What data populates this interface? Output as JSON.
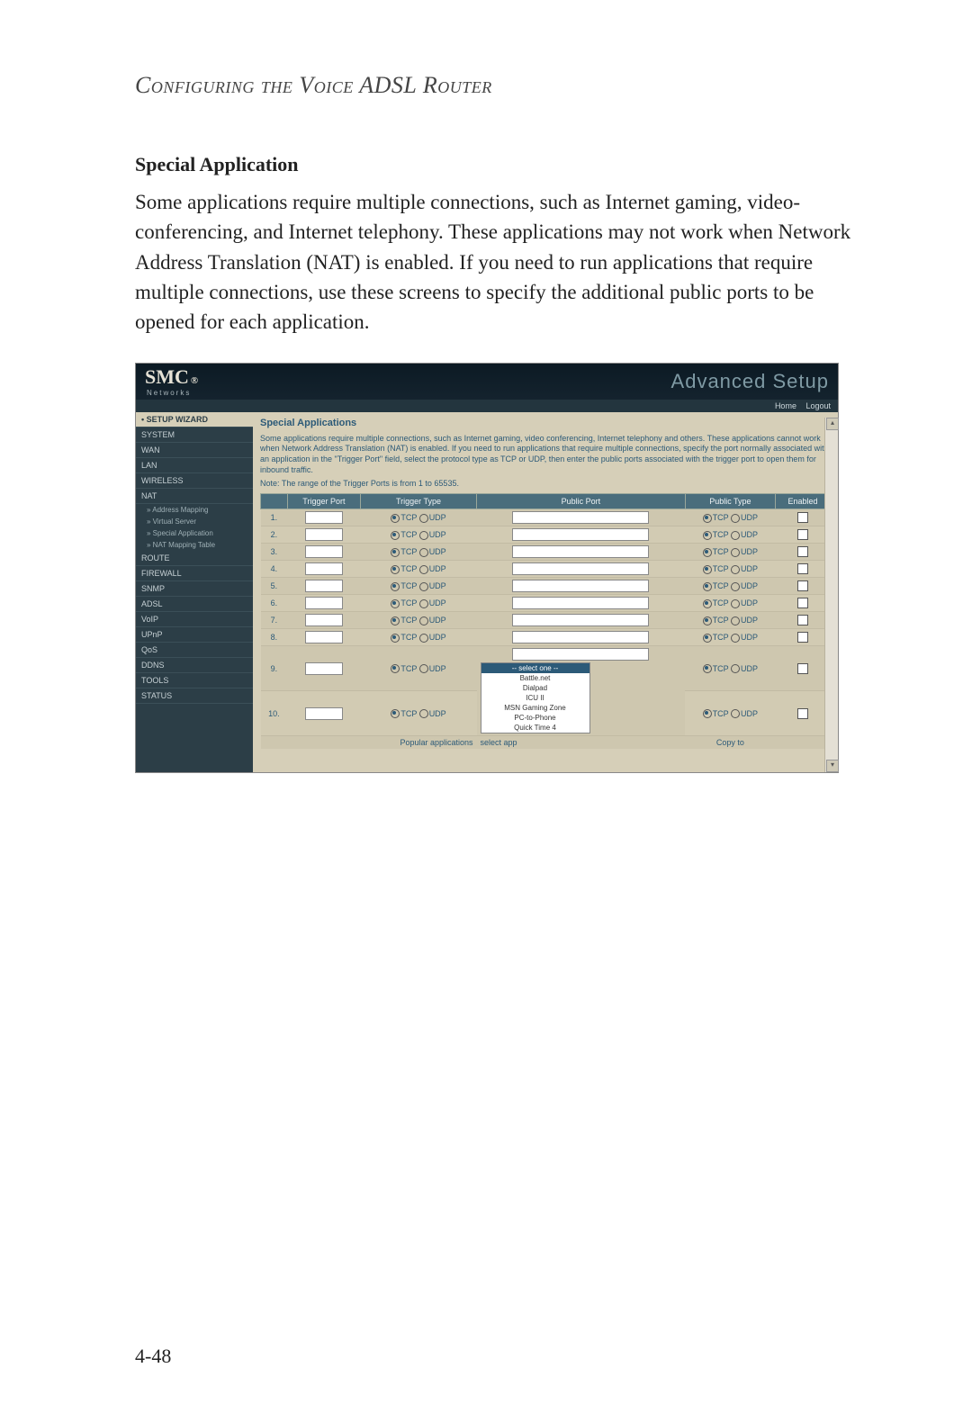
{
  "chapter_title": "Configuring the Voice ADSL Router",
  "section_heading": "Special Application",
  "body_text": "Some applications require multiple connections, such as Internet gaming, video-conferencing, and Internet telephony. These applications may not work when Network Address Translation (NAT) is enabled. If you need to run applications that require multiple connections, use these screens to specify the additional public ports to be opened for each application.",
  "page_number": "4-48",
  "shot": {
    "brand": "SMC",
    "brand_sub": "Networks",
    "reg": "®",
    "page_title": "Advanced Setup",
    "home": "Home",
    "logout": "Logout",
    "sidebar": {
      "wizard": "• SETUP WIZARD",
      "items": [
        "SYSTEM",
        "WAN",
        "LAN",
        "WIRELESS",
        "NAT"
      ],
      "nat_sub": [
        "» Address Mapping",
        "» Virtual Server",
        "» Special Application",
        "» NAT Mapping Table"
      ],
      "items2": [
        "ROUTE",
        "FIREWALL",
        "SNMP",
        "ADSL",
        "VoIP",
        "UPnP",
        "QoS",
        "DDNS",
        "TOOLS",
        "STATUS"
      ]
    },
    "content": {
      "heading": "Special Applications",
      "intro": "Some applications require multiple connections, such as Internet gaming, video conferencing, Internet telephony and others. These applications cannot work when Network Address Translation (NAT) is enabled. If you need to run applications that require multiple connections, specify the port normally associated with an application in the \"Trigger Port\" field, select the protocol type as TCP or UDP, then enter the public ports associated with the trigger port to open them for inbound traffic.",
      "note": "Note: The range of the Trigger Ports is from 1 to 65535.",
      "headers": [
        "",
        "Trigger Port",
        "Trigger Type",
        "Public Port",
        "Public Type",
        "Enabled"
      ],
      "tcp": "TCP",
      "udp": "UDP",
      "rows": [
        "1.",
        "2.",
        "3.",
        "4.",
        "5.",
        "6.",
        "7.",
        "8.",
        "9.",
        "10."
      ],
      "popular_label": "Popular applications",
      "dropdown_sel": "-- select one --",
      "dropdown_opts": [
        "Battle.net",
        "Dialpad",
        "ICU II",
        "MSN Gaming Zone",
        "PC-to-Phone",
        "Quick Time 4"
      ],
      "copy_to": "Copy to",
      "select_app": "select app"
    }
  }
}
